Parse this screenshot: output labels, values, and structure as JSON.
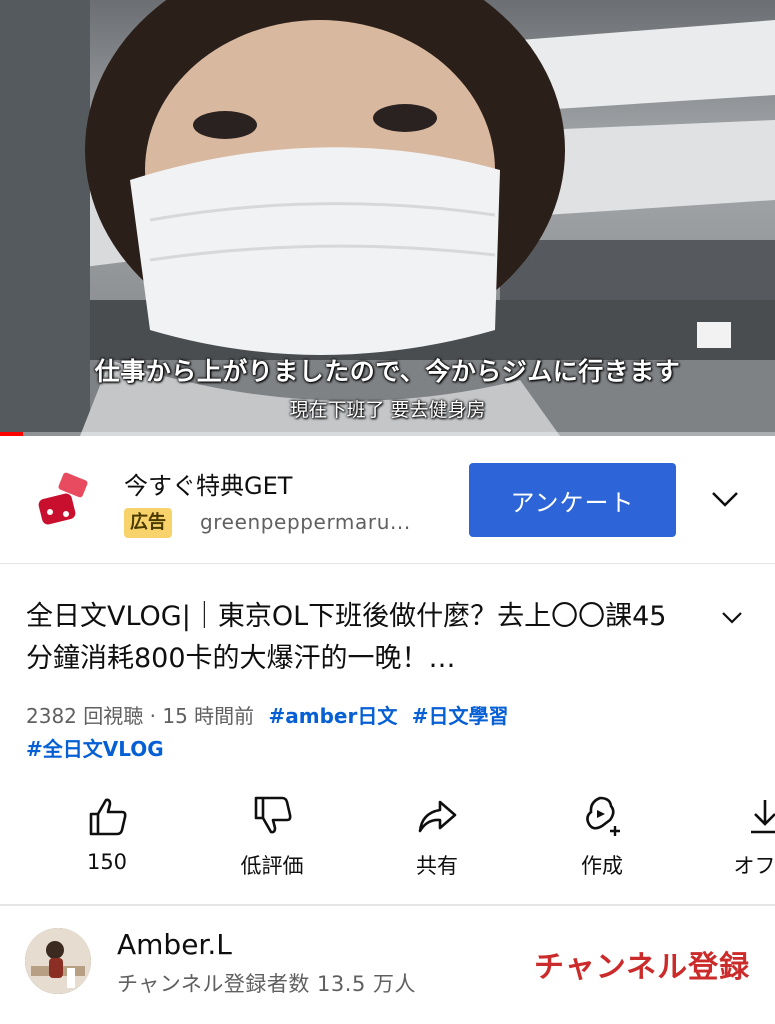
{
  "video": {
    "subtitle_jp": "仕事から上がりましたので、今からジムに行きます",
    "subtitle_zh": "現在下班了 要去健身房",
    "progress": 0.03
  },
  "ad": {
    "title": "今すぐ特典GET",
    "badge": "広告",
    "domain": "greenpeppermaru...",
    "button_label": "アンケート"
  },
  "video_info": {
    "title": "全日文VLOG|｜東京OL下班後做什麼？去上〇〇課45分鐘消耗800卡的大爆汗的一晚！…",
    "views": "2382 回視聴",
    "separator": "·",
    "time_ago": "15 時間前",
    "tags": [
      "#amber日文",
      "#日文學習",
      "#全日文VLOG"
    ]
  },
  "actions": [
    {
      "label": "150",
      "icon": "thumbs-up-icon"
    },
    {
      "label": "低評価",
      "icon": "thumbs-down-icon"
    },
    {
      "label": "共有",
      "icon": "share-icon"
    },
    {
      "label": "作成",
      "icon": "remix-icon"
    },
    {
      "label": "オフラ",
      "icon": "download-icon"
    }
  ],
  "channel": {
    "name": "Amber.L",
    "subscribers": "チャンネル登録者数 13.5 万人",
    "subscribe_label": "チャンネル登録"
  },
  "colors": {
    "accent_blue": "#2d65d8",
    "link_blue": "#065fd4",
    "subscribe_red": "#cc2b2b",
    "ad_badge": "#f8d36b"
  }
}
